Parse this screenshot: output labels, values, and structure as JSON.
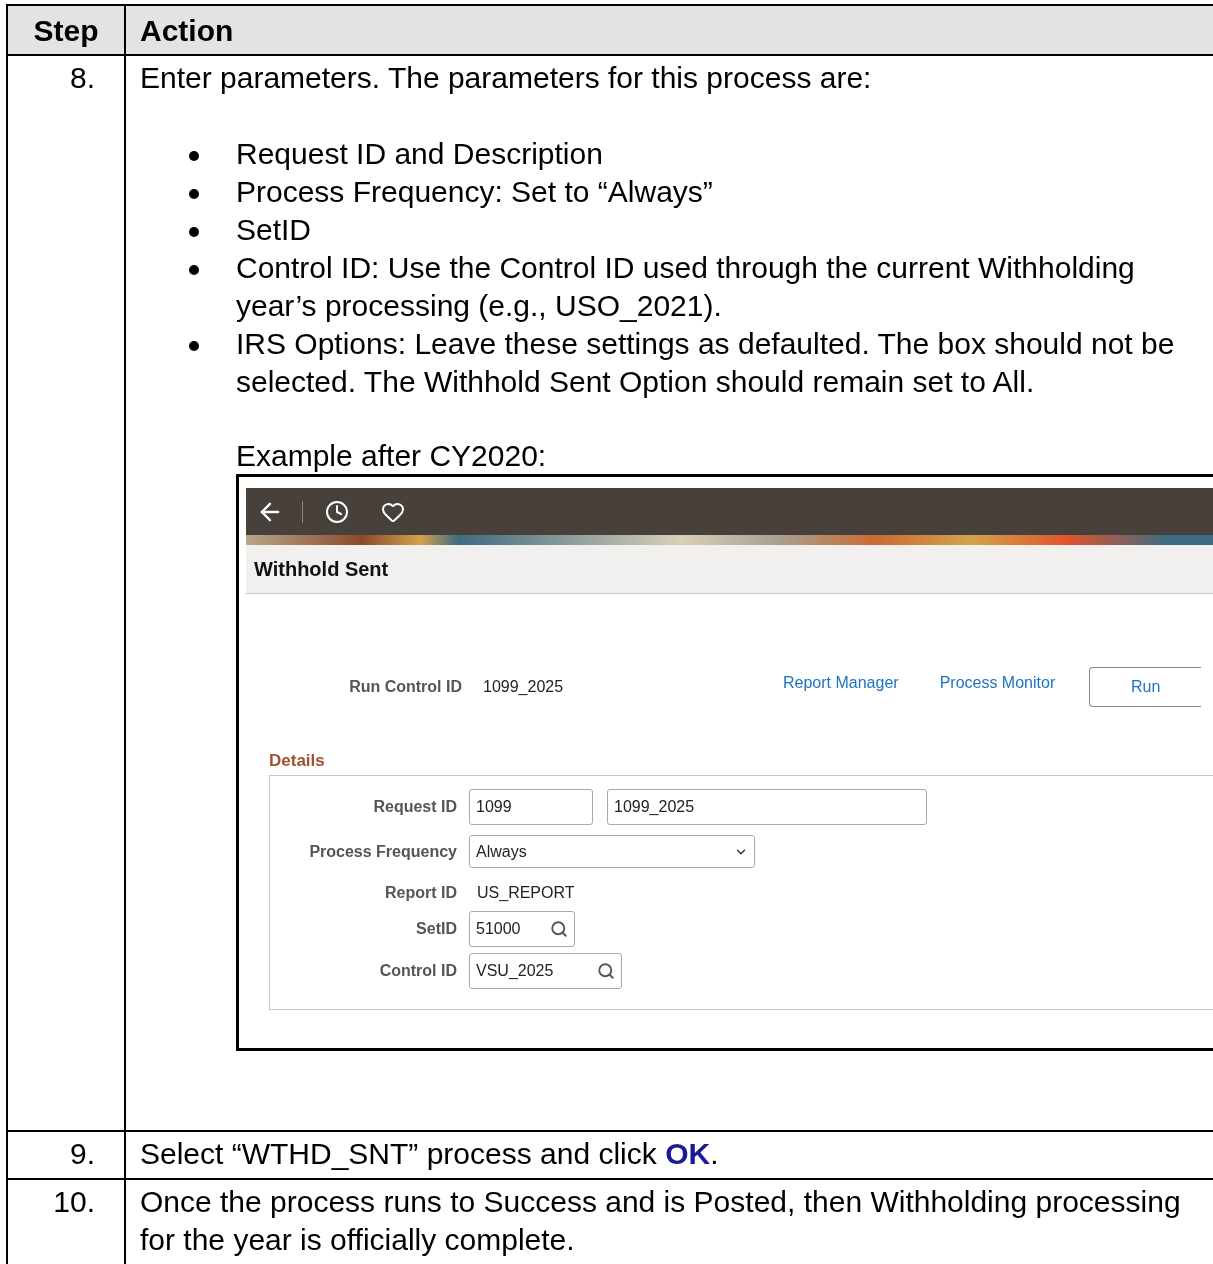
{
  "table": {
    "columns": [
      "Step",
      "Action"
    ],
    "rows": [
      {
        "step": "8.",
        "kind": "example",
        "intro": "Enter parameters. The parameters for this process are:",
        "bullets": [
          "Request ID and Description",
          "Process Frequency: Set to “Always”",
          "SetID",
          "Control ID: Use the Control ID used through the current Withholding year’s processing (e.g., USO_2021).",
          "IRS Options: Leave these settings as defaulted. The box should not be selected. The Withhold Sent Option should remain set to All."
        ],
        "caption": "Example after CY2020:",
        "screen": {
          "title": "Withhold Sent",
          "run_control": {
            "label": "Run Control ID",
            "value": "1099_2025"
          },
          "links": [
            "Report Manager",
            "Process Monitor"
          ],
          "run_button": "Run",
          "section": "Details",
          "fields": [
            {
              "kind": "pair",
              "label": "Request ID",
              "values": [
                "1099",
                "1099_2025"
              ]
            },
            {
              "kind": "select",
              "label": "Process Frequency",
              "value": "Always"
            },
            {
              "kind": "text",
              "label": "Report ID",
              "value": "US_REPORT"
            },
            {
              "kind": "lookup",
              "label": "SetID",
              "value": "51000"
            },
            {
              "kind": "lookup",
              "label": "Control ID",
              "value": "VSU_2025"
            }
          ]
        }
      },
      {
        "step": "9.",
        "kind": "text",
        "text": "Select “WTHD_SNT” process and click **OK**."
      },
      {
        "step": "10.",
        "kind": "text",
        "text": "Once the process runs to Success and is Posted, then Withholding processing for the year is officially complete."
      }
    ]
  }
}
